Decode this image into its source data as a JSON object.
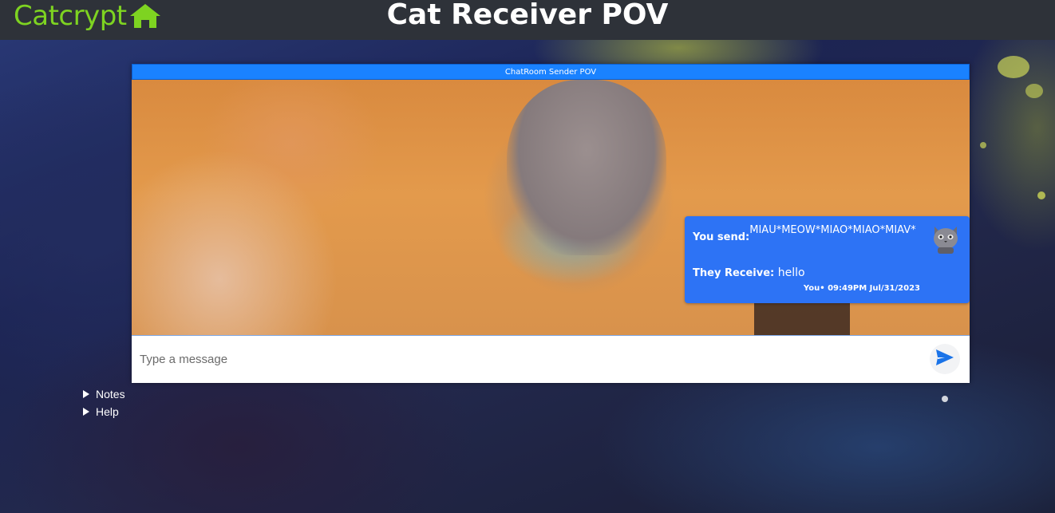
{
  "header": {
    "brand": "Catcrypt",
    "brand_icon": "home-icon",
    "title": "Cat Receiver POV"
  },
  "chat": {
    "title": "ChatRoom Sender POV",
    "message": {
      "send_label": "You send:",
      "send_value": "MIAU*MEOW*MIAO*MIAO*MIAV*",
      "receive_label": "They Receive:",
      "receive_value": "hello",
      "meta": "You• 09:49PM Jul/31/2023",
      "avatar_icon": "cat-avatar-icon"
    },
    "composer": {
      "placeholder": "Type a message",
      "value": "",
      "send_icon": "send-icon"
    }
  },
  "sidebar": {
    "items": [
      {
        "label": "Notes"
      },
      {
        "label": "Help"
      }
    ]
  },
  "colors": {
    "brand": "#7ed321",
    "header_bg": "#2e3239",
    "chat_title_bg": "#1a82ff",
    "bubble_bg": "#2d73f5",
    "send_icon": "#1a73e8"
  }
}
